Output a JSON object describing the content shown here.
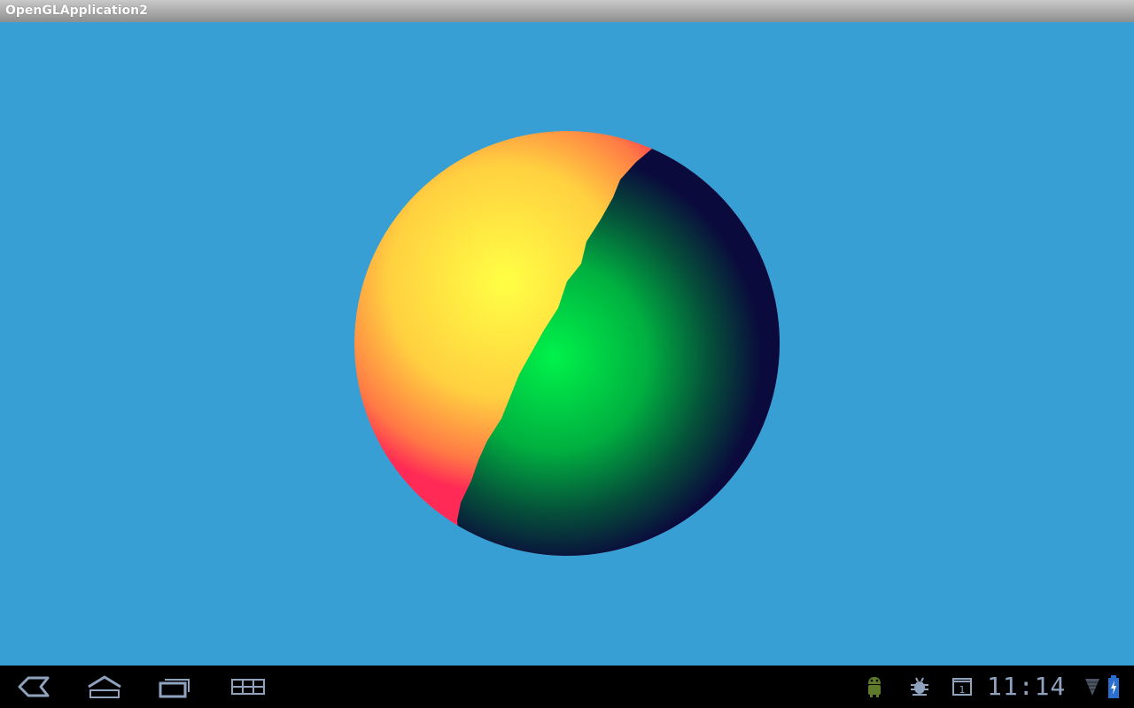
{
  "window": {
    "title": "OpenGLApplication2"
  },
  "canvas": {
    "background_color": "#389fd4",
    "sphere": {
      "lit_colors": [
        "#ffff44",
        "#ff2a55"
      ],
      "shadow_colors": [
        "#00f24a",
        "#0a0a3c"
      ]
    }
  },
  "system_bar": {
    "nav": {
      "back_icon": "back-icon",
      "home_icon": "home-icon",
      "recent_apps_icon": "recent-apps-icon",
      "menu_icon": "menu-icon"
    },
    "status": {
      "notification_icon": "android-notification-icon",
      "debug_icon": "usb-debugging-icon",
      "calendar_icon": "calendar-icon",
      "calendar_day": "1",
      "clock": "11:14",
      "signal_icon": "signal-icon",
      "battery_icon": "battery-charging-icon"
    },
    "icon_color": "#8fa3bf"
  }
}
